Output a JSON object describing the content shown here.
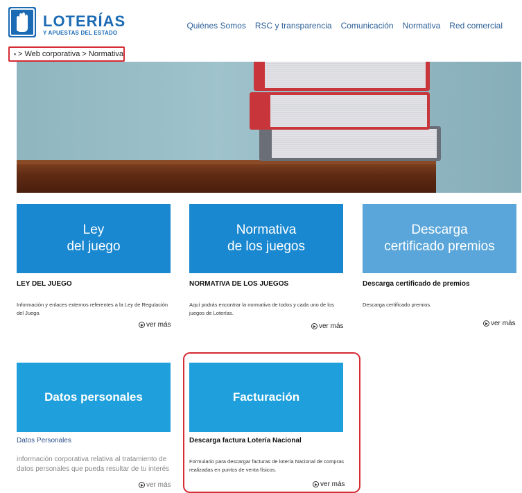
{
  "header": {
    "logo_title": "LOTERÍAS",
    "logo_subtitle": "Y APUESTAS DEL ESTADO",
    "nav": [
      "Quiénes Somos",
      "RSC y transparencia",
      "Comunicación",
      "Normativa",
      "Red comercial"
    ]
  },
  "breadcrumb": {
    "home_icon": "home-icon",
    "text": "> Web corporativa > Normativa"
  },
  "cards": [
    {
      "image_text": "Ley\ndel juego",
      "title": "LEY DEL JUEGO",
      "description": "Información y enlaces externos referentes a la Ley de Regulación del Juego.",
      "link": "ver más",
      "color": "#1a88d0"
    },
    {
      "image_text": "Normativa\nde los juegos",
      "title": "NORMATIVA DE LOS JUEGOS",
      "description": "Aquí podrás encontrar la normativa de todos y cada uno de los juegos de Loterías.",
      "link": "ver más",
      "color": "#1a88d0"
    },
    {
      "image_text": "Descarga\ncertificado premios",
      "title": "Descarga certificado de premios",
      "description": "Descarga certificado premios.",
      "link": "ver más",
      "color": "#5aa6da"
    },
    {
      "image_text": "Datos personales",
      "title": "Datos Personales",
      "description": "información corporativa relativa al tratamiento de datos personales que pueda resultar de tu interés",
      "link": "ver más",
      "color": "#1fa0dc"
    },
    {
      "image_text": "Facturación",
      "title": "Descarga factura Lotería Nacional",
      "description": "Formulario para descargar facturas de lotería Nacional de compras realizadas en puntos de venta físicos.",
      "link": "ver más",
      "color": "#1fa0dc"
    }
  ],
  "colors": {
    "brand_blue": "#1b6ab4",
    "highlight_red": "#d52b35"
  }
}
